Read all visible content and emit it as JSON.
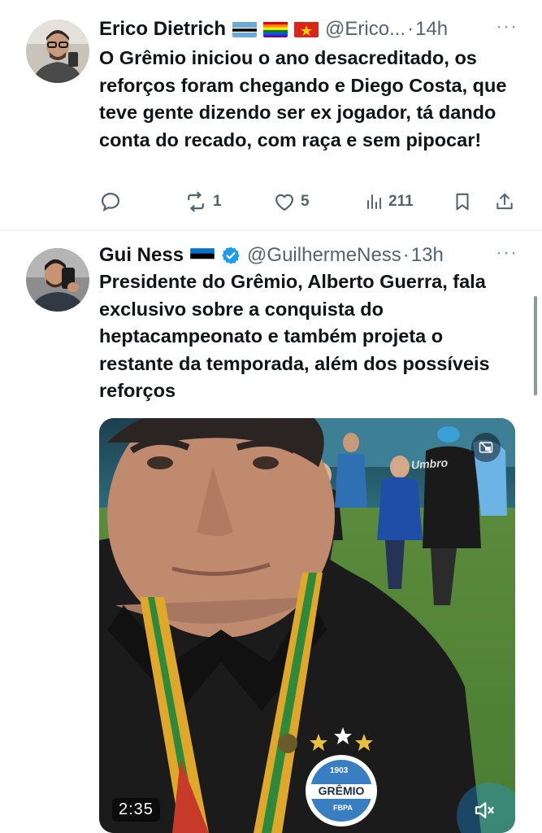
{
  "tweets": [
    {
      "author_name": "Erico Dietrich",
      "handle": "@Erico...",
      "separator": "·",
      "time": "14h",
      "flags": [
        "botswana-flag",
        "rainbow-flag",
        "vietnam-flag"
      ],
      "text": "O Grêmio iniciou o ano desacreditado, os reforços foram chegando e Diego Costa, que teve gente dizendo ser ex jogador, tá dando conta do recado, com raça e sem pipocar!",
      "replies": "",
      "retweets": "1",
      "likes": "5",
      "views": "211"
    },
    {
      "author_name": "Gui Ness",
      "handle": "@GuilhermeNess",
      "separator": "·",
      "time": "13h",
      "flags": [
        "estonia-flag"
      ],
      "verified": true,
      "text": "Presidente do Grêmio, Alberto Guerra, fala exclusivo sobre a conquista do heptacampeonato e também projeta o restante da temporada, além dos possíveis reforços",
      "video": {
        "duration": "2:35",
        "badge_text": "GRÊMIO",
        "badge_year": "1903",
        "badge_sub": "FBPA",
        "shirt_text": "Umbro"
      }
    }
  ],
  "more_label": "···",
  "colors": {
    "text": "#0f1419",
    "secondary": "#536471",
    "accent": "#1d9bf0"
  }
}
